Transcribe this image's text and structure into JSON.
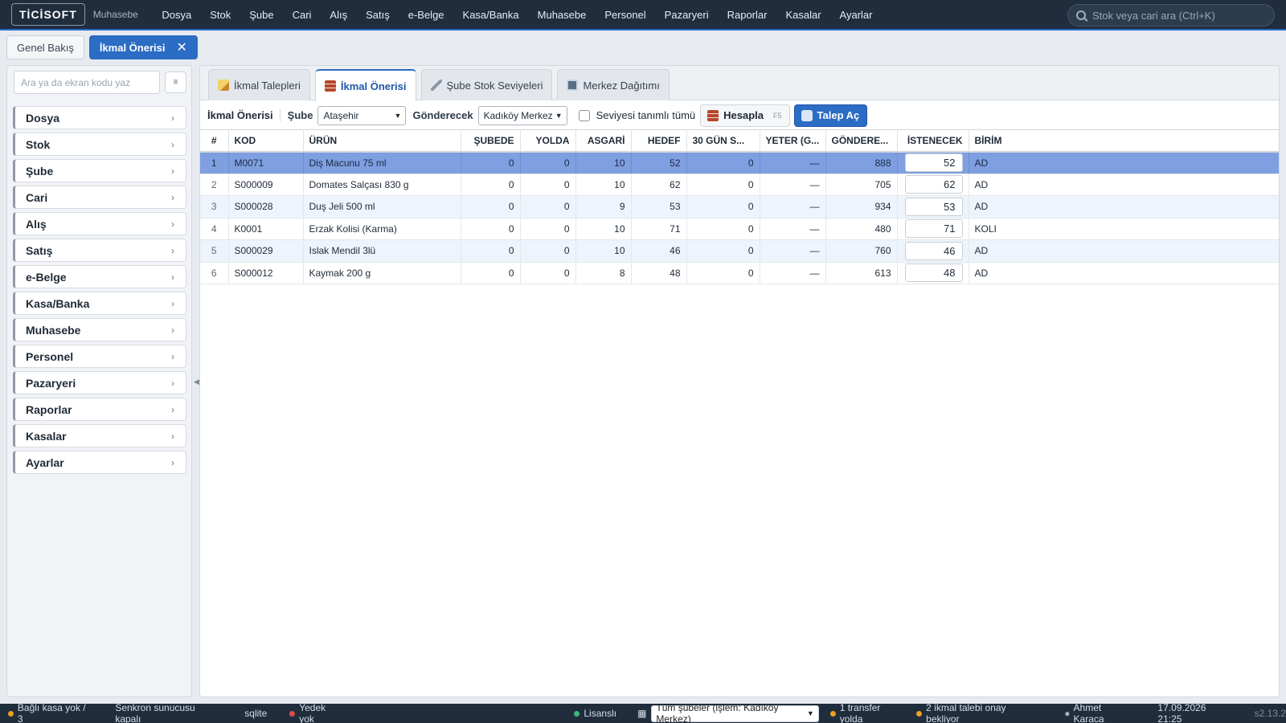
{
  "app": {
    "logo": "TİCİSOFT",
    "subtitle": "Muhasebe"
  },
  "menu": [
    "Dosya",
    "Stok",
    "Şube",
    "Cari",
    "Alış",
    "Satış",
    "e-Belge",
    "Kasa/Banka",
    "Muhasebe",
    "Personel",
    "Pazaryeri",
    "Raporlar",
    "Kasalar",
    "Ayarlar"
  ],
  "search": {
    "placeholder": "Stok veya cari ara (Ctrl+K)"
  },
  "doc_tabs": {
    "overview": "Genel Bakış",
    "active": "İkmal Önerisi",
    "close": "✕"
  },
  "sidebar": {
    "search_placeholder": "Ara ya da ekran kodu yaz",
    "button_icon": "≡",
    "items": [
      "Dosya",
      "Stok",
      "Şube",
      "Cari",
      "Alış",
      "Satış",
      "e-Belge",
      "Kasa/Banka",
      "Muhasebe",
      "Personel",
      "Pazaryeri",
      "Raporlar",
      "Kasalar",
      "Ayarlar"
    ]
  },
  "sub_tabs": [
    {
      "label": "İkmal Talepleri",
      "icon": "pencil-note-icon"
    },
    {
      "label": "İkmal Önerisi",
      "icon": "brick-grid-icon"
    },
    {
      "label": "Şube Stok Seviyeleri",
      "icon": "ruler-icon"
    },
    {
      "label": "Merkez Dağıtımı",
      "icon": "shuffle-icon"
    }
  ],
  "toolbar": {
    "title": "İkmal Önerisi",
    "sube_label": "Şube",
    "sube_value": "Ataşehir",
    "sender_label": "Gönderecek",
    "sender_value": "Kadıköy Merkez",
    "check_label": "Seviyesi tanımlı tümü",
    "calc_label": "Hesapla",
    "calc_key": "F5",
    "open_label": "Talep Aç"
  },
  "table": {
    "headers": [
      "#",
      "KOD",
      "ÜRÜN",
      "ŞUBEDE",
      "YOLDA",
      "ASGARİ",
      "HEDEF",
      "30 GÜN S...",
      "YETER (G...",
      "GÖNDERE...",
      "İSTENECEK",
      "BİRİM"
    ],
    "rows": [
      {
        "no": "1",
        "kod": "M0071",
        "urun": "Diş Macunu 75 ml",
        "subede": "0",
        "yolda": "0",
        "asgari": "10",
        "hedef": "52",
        "gun30": "0",
        "yeter": "—",
        "gondere": "888",
        "istenecek": "52",
        "birim": "AD"
      },
      {
        "no": "2",
        "kod": "S000009",
        "urun": "Domates Salçası 830 g",
        "subede": "0",
        "yolda": "0",
        "asgari": "10",
        "hedef": "62",
        "gun30": "0",
        "yeter": "—",
        "gondere": "705",
        "istenecek": "62",
        "birim": "AD"
      },
      {
        "no": "3",
        "kod": "S000028",
        "urun": "Duş Jeli 500 ml",
        "subede": "0",
        "yolda": "0",
        "asgari": "9",
        "hedef": "53",
        "gun30": "0",
        "yeter": "—",
        "gondere": "934",
        "istenecek": "53",
        "birim": "AD"
      },
      {
        "no": "4",
        "kod": "K0001",
        "urun": "Erzak Kolisi (Karma)",
        "subede": "0",
        "yolda": "0",
        "asgari": "10",
        "hedef": "71",
        "gun30": "0",
        "yeter": "—",
        "gondere": "480",
        "istenecek": "71",
        "birim": "KOLI"
      },
      {
        "no": "5",
        "kod": "S000029",
        "urun": "Islak Mendil 3lü",
        "subede": "0",
        "yolda": "0",
        "asgari": "10",
        "hedef": "46",
        "gun30": "0",
        "yeter": "—",
        "gondere": "760",
        "istenecek": "46",
        "birim": "AD"
      },
      {
        "no": "6",
        "kod": "S000012",
        "urun": "Kaymak 200 g",
        "subede": "0",
        "yolda": "0",
        "asgari": "8",
        "hedef": "48",
        "gun30": "0",
        "yeter": "—",
        "gondere": "613",
        "istenecek": "48",
        "birim": "AD"
      }
    ]
  },
  "status": {
    "kasa": "Bağlı kasa yok / 3",
    "sync": "Senkron sunucusu kapalı",
    "db": "sqlite",
    "backup": "Yedek yok",
    "license": "Lisanslı",
    "branch_select": "Tüm şubeler (işlem: Kadıköy Merkez)",
    "transfer": "1 transfer yolda",
    "pending": "2 ikmal talebi onay bekliyor",
    "user": "Ahmet Karaca",
    "datetime": "17.09.2026 21:25",
    "version": "s2.13.2"
  },
  "colors": {
    "accent": "#2b6cc4",
    "topbar": "#1f2d3d",
    "selected_row": "#7f9fe0",
    "green": "#3cb878",
    "red": "#e04848",
    "orange": "#e8a020"
  }
}
